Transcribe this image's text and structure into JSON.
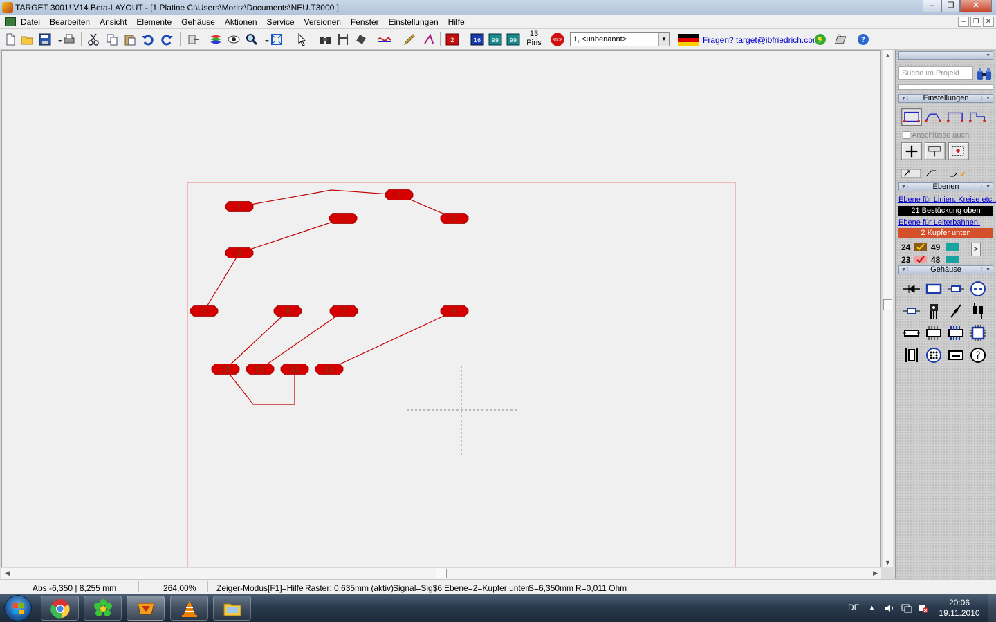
{
  "window": {
    "title": "TARGET 3001! V14 Beta-LAYOUT - [1 Platine C:\\Users\\Moritz\\Documents\\NEU.T3000 ]"
  },
  "menu": [
    "Datei",
    "Bearbeiten",
    "Ansicht",
    "Elemente",
    "Gehäuse",
    "Aktionen",
    "Service",
    "Versionen",
    "Fenster",
    "Einstellungen",
    "Hilfe"
  ],
  "toolbar": {
    "pins_count": "13",
    "pins_label": "Pins",
    "layer_select": "1, <unbenannt>",
    "help_link": "Fragen? target@ibfriedrich.com",
    "badge_red": "2",
    "badge_blue": "16",
    "badge_teal1": "99",
    "badge_teal2": "99",
    "stop_label": "STOP"
  },
  "board": {
    "pads": [
      {
        "label": "1"
      },
      {
        "label": "2"
      },
      {
        "label": "3"
      },
      {
        "label": "4"
      },
      {
        "label": "5"
      },
      {
        "label": "6"
      },
      {
        "label": "7"
      },
      {
        "label": "8"
      },
      {
        "label": "9"
      },
      {
        "label": "10"
      },
      {
        "label": "11"
      },
      {
        "label": "12"
      },
      {
        "label": "13"
      }
    ],
    "pad_color": "#d40000",
    "trace_color": "#c00000",
    "outline_color": "#f08080"
  },
  "panel": {
    "search_placeholder": "Suche im Projekt",
    "settings_header": "Einstellungen",
    "checkbox_label": "Anschlüsse auch",
    "layers_header": "Ebenen",
    "link_lines": "Ebene für Linien, Kreise etc.:",
    "layer_lines": "21 Bestückung oben",
    "link_traces": "Ebene für Leiterbahnen:",
    "layer_traces": "2 Kupfer unten",
    "layer_24": "24",
    "layer_23": "23",
    "layer_49": "49",
    "layer_48": "48",
    "expand_arrow": ">",
    "packages_header": "Gehäuse",
    "colors": {
      "layer_lines_bg": "#000000",
      "layer_traces_bg": "#d4502a",
      "layer_teal": "#1aa3a3"
    }
  },
  "status": {
    "coords": "Abs -6,350 | 8,255 mm",
    "zoom": "264,00%",
    "mode": "Zeiger-Modus",
    "help": "[F1]=Hilfe",
    "grid": "Raster: 0,635mm (aktiv)",
    "signal": "Signal=Sig$6",
    "layer": "Ebene=2=Kupfer unten",
    "width": "S=6,350mm",
    "resistance": "R=0,011 Ohm"
  },
  "taskbar": {
    "lang": "DE",
    "time": "20:06",
    "date": "19.11.2010"
  }
}
